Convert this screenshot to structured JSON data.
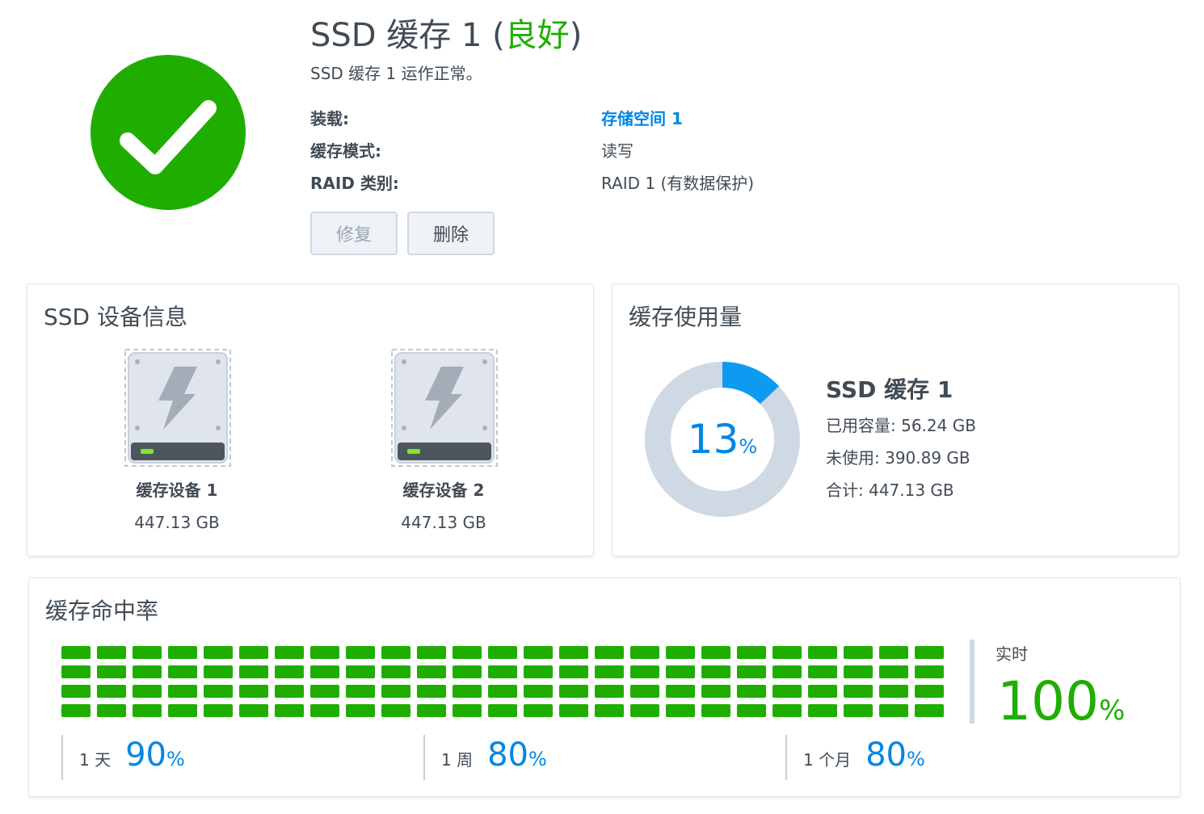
{
  "header": {
    "title_prefix": "SSD 缓存 1 (",
    "title_status": "良好",
    "title_suffix": ")",
    "subtitle": "SSD 缓存 1 运作正常。",
    "status_color": "#1fae00",
    "icon": "check-circle-icon"
  },
  "details": [
    {
      "label": "装载:",
      "value": "存储空间 1",
      "link": true
    },
    {
      "label": "缓存模式:",
      "value": "读写",
      "link": false
    },
    {
      "label": "RAID 类别:",
      "value": "RAID 1 (有数据保护)",
      "link": false
    }
  ],
  "buttons": {
    "repair": "修复",
    "delete": "删除"
  },
  "devices_card": {
    "title": "SSD 设备信息",
    "devices": [
      {
        "name": "缓存设备 1",
        "size": "447.13 GB",
        "icon": "ssd-drive-icon"
      },
      {
        "name": "缓存设备 2",
        "size": "447.13 GB",
        "icon": "ssd-drive-icon"
      }
    ]
  },
  "usage_card": {
    "title": "缓存使用量",
    "percent": 13,
    "percent_text": "13",
    "percent_unit": "%",
    "name": "SSD 缓存 1",
    "used": "已用容量: 56.24 GB",
    "unused": "未使用: 390.89 GB",
    "total": "合计: 447.13 GB",
    "colors": {
      "used": "#0d9bf2",
      "free": "#cfd9e3"
    }
  },
  "hit_rate_card": {
    "title": "缓存命中率",
    "grid": {
      "columns": 25,
      "rows": 4,
      "filled_percent": 100,
      "color": "#1fae00"
    },
    "realtime": {
      "label": "实时",
      "value": "100",
      "unit": "%"
    },
    "periods": [
      {
        "label": "1 天",
        "value": "90",
        "unit": "%"
      },
      {
        "label": "1 周",
        "value": "80",
        "unit": "%"
      },
      {
        "label": "1 个月",
        "value": "80",
        "unit": "%"
      }
    ]
  }
}
